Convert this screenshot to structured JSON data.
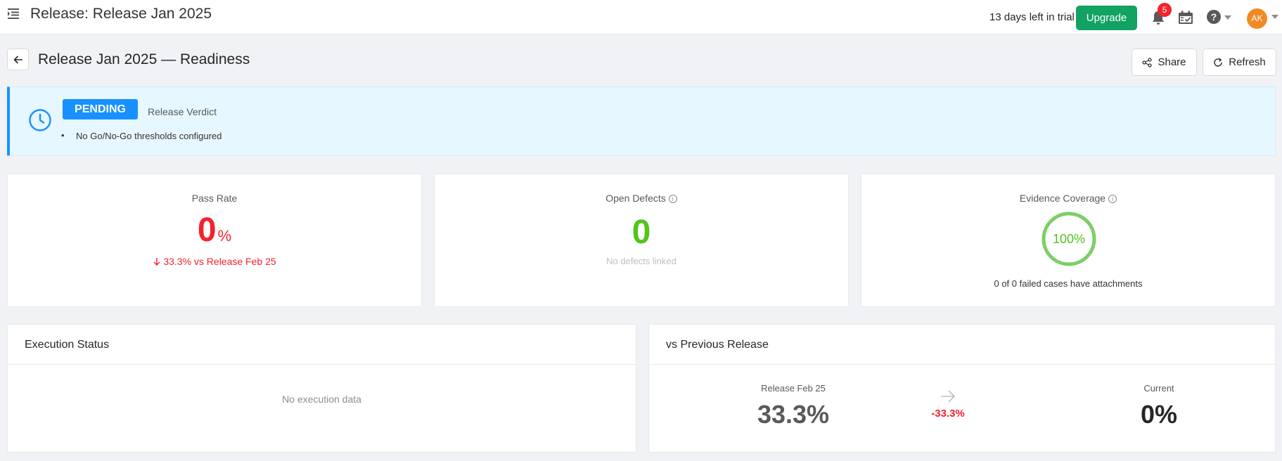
{
  "header": {
    "title": "Release: Release Jan 2025",
    "trial_text": "13 days left in trial",
    "upgrade_label": "Upgrade",
    "notification_count": "5",
    "avatar_initials": "AK",
    "help_glyph": "?",
    "icons": [
      "menu-icon",
      "bell-icon",
      "calendar-check-icon",
      "help-icon",
      "chevron-down-icon"
    ],
    "colors": {
      "upgrade": "#12a263",
      "badge": "#f5222d",
      "avatar": "#f08a24"
    }
  },
  "page": {
    "title": "Release Jan 2025 — Readiness",
    "share_label": "Share",
    "refresh_label": "Refresh"
  },
  "verdict": {
    "status": "PENDING",
    "label": "Release Verdict",
    "notes": [
      "No Go/No-Go thresholds configured"
    ],
    "accent_color": "#1890ff"
  },
  "metrics": {
    "pass_rate": {
      "title": "Pass Rate",
      "value": "0",
      "unit": "%",
      "delta": "33.3% vs Release Feb 25",
      "delta_direction": "down"
    },
    "open_defects": {
      "title": "Open Defects",
      "value": "0",
      "subtitle": "No defects linked"
    },
    "evidence_coverage": {
      "title": "Evidence Coverage",
      "value_text": "100%",
      "value": 1.0,
      "subtitle": "0 of 0 failed cases have attachments"
    }
  },
  "execution_status": {
    "title": "Execution Status",
    "empty_text": "No execution data"
  },
  "comparison": {
    "title": "vs Previous Release",
    "previous_label": "Release Feb 25",
    "previous_value": "33.3%",
    "delta": "-33.3%",
    "current_label": "Current",
    "current_value": "0%"
  }
}
